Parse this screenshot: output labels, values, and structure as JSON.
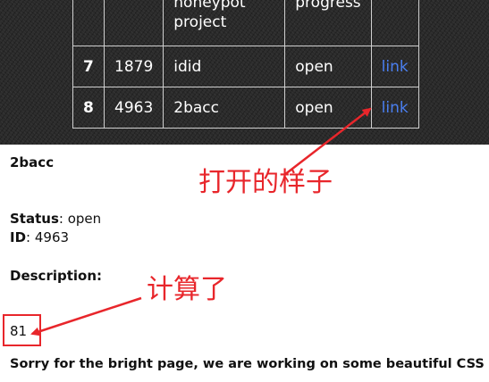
{
  "table": {
    "rows": [
      {
        "num": "",
        "id": "",
        "name": "honeypot project",
        "status": "progress",
        "link": ""
      },
      {
        "num": "7",
        "id": "1879",
        "name": "idid",
        "status": "open",
        "link": "link"
      },
      {
        "num": "8",
        "id": "4963",
        "name": "2bacc",
        "status": "open",
        "link": "link"
      }
    ]
  },
  "detail": {
    "title": "2bacc",
    "status_label": "Status",
    "status_value": "open",
    "id_label": "ID",
    "id_value": "4963",
    "description_label": "Description:",
    "description_value": "81",
    "footer_note": "Sorry for the bright page, we are working on some beautiful CSS"
  },
  "annotations": {
    "open_label": "打开的样子",
    "calc_label": "计算了",
    "color": "#e8262b"
  },
  "colors": {
    "link": "#4a7ff0",
    "dark_background": "#2a2a2a"
  }
}
